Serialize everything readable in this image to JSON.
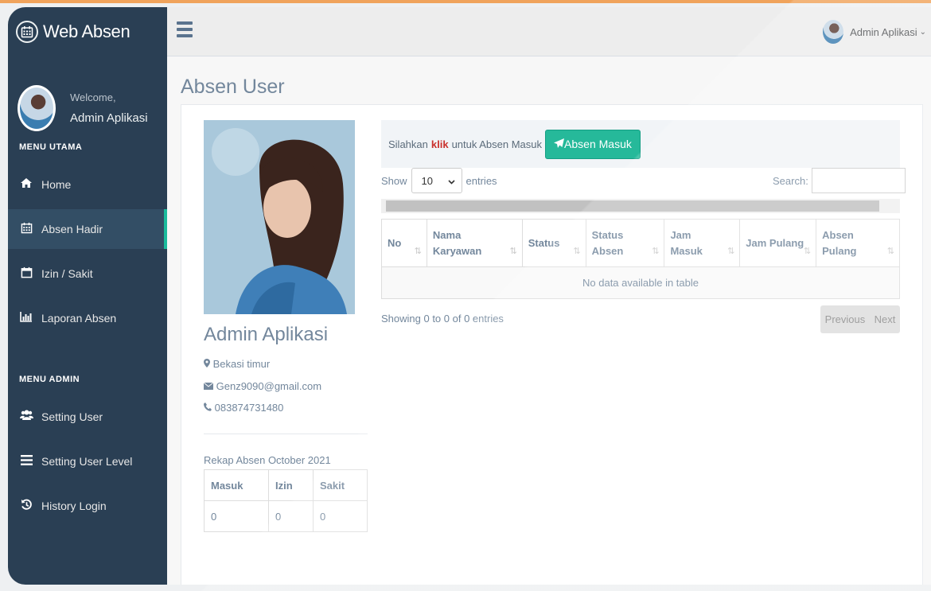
{
  "brand": {
    "title": "Web Absen",
    "icon": "calendar-icon"
  },
  "profile": {
    "welcome": "Welcome,",
    "name": "Admin Aplikasi"
  },
  "menu_utama": {
    "title": "MENU UTAMA",
    "items": [
      {
        "label": "Home",
        "icon": "home-icon"
      },
      {
        "label": "Absen Hadir",
        "icon": "calendar-icon",
        "active": true
      },
      {
        "label": "Izin / Sakit",
        "icon": "calendar-blank-icon"
      },
      {
        "label": "Laporan Absen",
        "icon": "bar-chart-icon"
      }
    ]
  },
  "menu_admin": {
    "title": "MENU ADMIN",
    "items": [
      {
        "label": "Setting User",
        "icon": "users-icon"
      },
      {
        "label": "Setting User Level",
        "icon": "list-icon"
      },
      {
        "label": "History Login",
        "icon": "history-icon"
      }
    ]
  },
  "topnav": {
    "user_name": "Admin Aplikasi"
  },
  "page": {
    "title": "Absen User"
  },
  "user_card": {
    "name": "Admin Aplikasi",
    "location": "Bekasi timur",
    "email": "Genz9090@gmail.com",
    "phone": "083874731480"
  },
  "rekap": {
    "title": "Rekap Absen October 2021",
    "headers": [
      "Masuk",
      "Izin",
      "Sakit"
    ],
    "values": [
      "0",
      "0",
      "0"
    ]
  },
  "absen_prompt": {
    "before": "Silahkan",
    "klik": "klik",
    "after": "untuk Absen Masuk",
    "button": "Absen Masuk"
  },
  "datatable": {
    "show_label": "Show",
    "entries_label": "entries",
    "length_value": "10",
    "search_label": "Search:",
    "columns": [
      [
        "No"
      ],
      [
        "Nama",
        "Karyawan"
      ],
      [
        "Status"
      ],
      [
        "Status",
        "Absen"
      ],
      [
        "Jam",
        "Masuk"
      ],
      [
        "Jam Pulang"
      ],
      [
        "Absen",
        "Pulang"
      ]
    ],
    "empty": "No data available in table",
    "info": "Showing 0 to 0 of 0 entries",
    "prev": "Previous",
    "next": "Next"
  },
  "colors": {
    "sidebar": "#2a3f54",
    "accent": "#26b99a",
    "klik": "#c9302c"
  }
}
